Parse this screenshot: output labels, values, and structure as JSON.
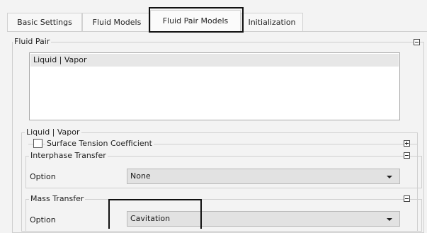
{
  "tabs": [
    {
      "label": "Basic Settings"
    },
    {
      "label": "Fluid Models"
    },
    {
      "label": "Fluid Pair Models"
    },
    {
      "label": "Initialization"
    }
  ],
  "fluid_pair": {
    "title": "Fluid Pair",
    "list_items": [
      "Liquid | Vapor"
    ]
  },
  "pair_section": {
    "title": "Liquid | Vapor",
    "surface_tension_label": "Surface Tension Coefficient",
    "surface_tension_checked": false,
    "interphase": {
      "title": "Interphase Transfer",
      "option_label": "Option",
      "option_value": "None"
    },
    "mass_transfer": {
      "title": "Mass Transfer",
      "option_label": "Option",
      "option_value": "Cavitation"
    }
  }
}
